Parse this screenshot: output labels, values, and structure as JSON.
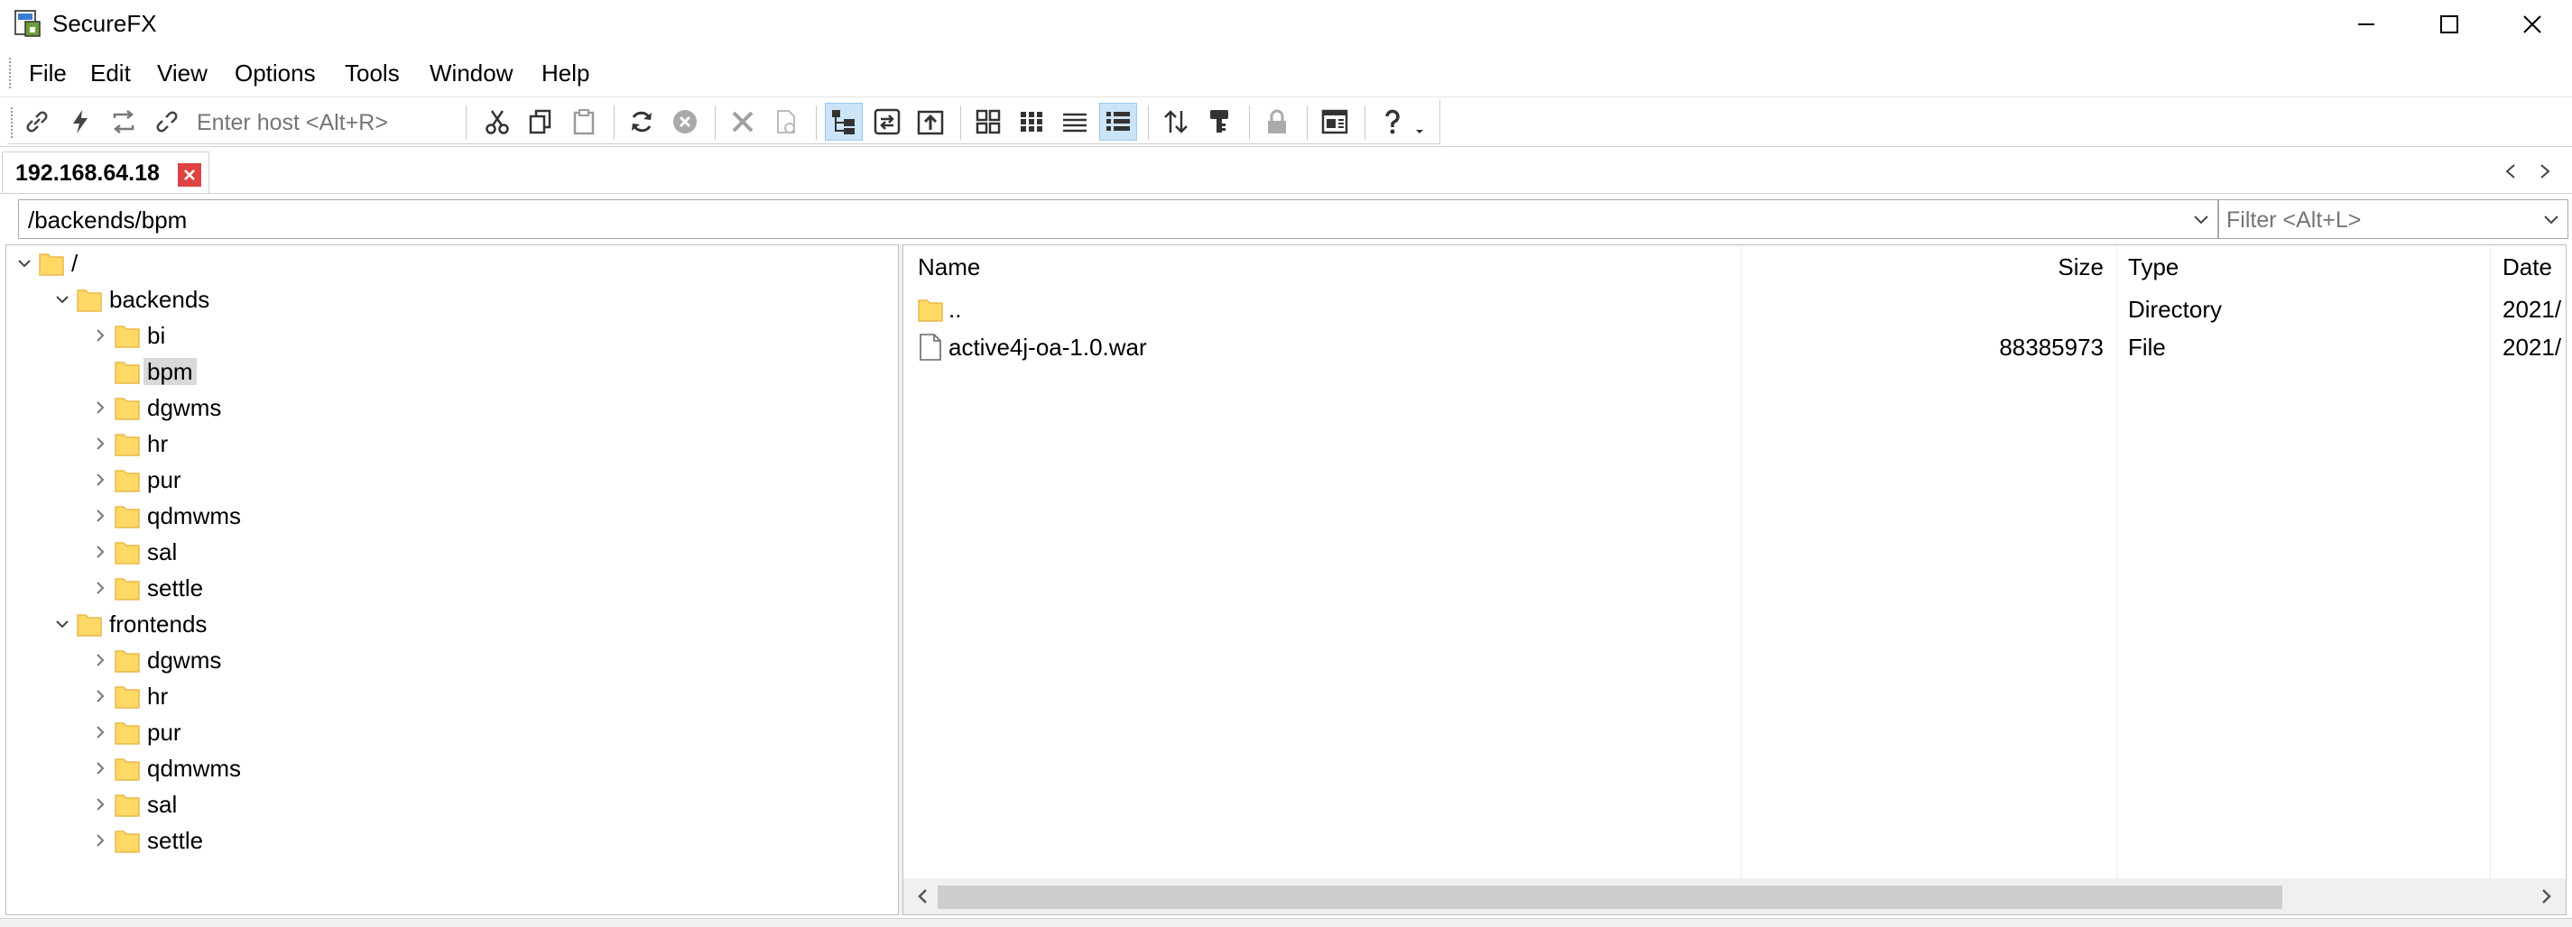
{
  "window": {
    "title": "SecureFX"
  },
  "menu": [
    {
      "label": "File"
    },
    {
      "label": "Edit"
    },
    {
      "label": "View"
    },
    {
      "label": "Options"
    },
    {
      "label": "Tools"
    },
    {
      "label": "Window"
    },
    {
      "label": "Help"
    }
  ],
  "toolbar": {
    "host_placeholder": "Enter host <Alt+R>",
    "buttons": [
      "connect-icon",
      "quick-connect-icon",
      "reconnect-icon",
      "disconnect-icon",
      "cut-icon",
      "copy-icon",
      "paste-icon",
      "refresh-icon",
      "stop-icon",
      "delete-icon",
      "properties-icon",
      "tree-view-icon",
      "sync-browse-icon",
      "parent-folder-icon",
      "large-icons-icon",
      "small-icons-icon",
      "list-view-icon",
      "details-view-icon",
      "sort-icon",
      "filter-icon",
      "lock-icon",
      "session-manager-icon",
      "help-icon"
    ],
    "active_buttons": [
      "tree-view-icon",
      "details-view-icon"
    ]
  },
  "session_tab": {
    "label": "192.168.64.18"
  },
  "path": {
    "value": "/backends/bpm",
    "filter_placeholder": "Filter <Alt+L>"
  },
  "tree": [
    {
      "label": "/",
      "level": 0,
      "expanded": true
    },
    {
      "label": "backends",
      "level": 1,
      "expanded": true
    },
    {
      "label": "bi",
      "level": 2,
      "expanded": false
    },
    {
      "label": "bpm",
      "level": 2,
      "expanded": null,
      "selected": true
    },
    {
      "label": "dgwms",
      "level": 2,
      "expanded": false
    },
    {
      "label": "hr",
      "level": 2,
      "expanded": false
    },
    {
      "label": "pur",
      "level": 2,
      "expanded": false
    },
    {
      "label": "qdmwms",
      "level": 2,
      "expanded": false
    },
    {
      "label": "sal",
      "level": 2,
      "expanded": false
    },
    {
      "label": "settle",
      "level": 2,
      "expanded": false
    },
    {
      "label": "frontends",
      "level": 1,
      "expanded": true
    },
    {
      "label": "dgwms",
      "level": 2,
      "expanded": false
    },
    {
      "label": "hr",
      "level": 2,
      "expanded": false
    },
    {
      "label": "pur",
      "level": 2,
      "expanded": false
    },
    {
      "label": "qdmwms",
      "level": 2,
      "expanded": false
    },
    {
      "label": "sal",
      "level": 2,
      "expanded": false
    },
    {
      "label": "settle",
      "level": 2,
      "expanded": false
    }
  ],
  "file_list": {
    "columns": [
      "Name",
      "Size",
      "Type",
      "Date"
    ],
    "rows": [
      {
        "name": "..",
        "size": "",
        "type": "Directory",
        "date": "2021/",
        "icon": "folder-icon"
      },
      {
        "name": "active4j-oa-1.0.war",
        "size": "88385973",
        "type": "File",
        "date": "2021/",
        "icon": "file-icon"
      }
    ]
  },
  "colors": {
    "folder": "#ffd966",
    "folder_dark": "#e8b84a",
    "selection": "#d9d9d9",
    "active_button": "#cce4f7",
    "tab_close": "#e04343"
  }
}
